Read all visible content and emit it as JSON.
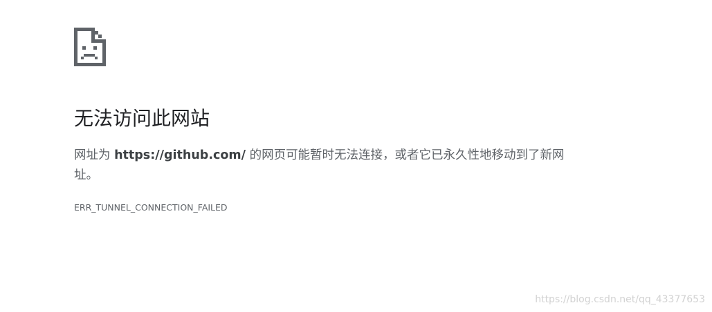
{
  "error_page": {
    "icon": "sad-page-icon",
    "heading": "无法访问此网站",
    "message_prefix": "网址为 ",
    "url": "https://github.com/",
    "message_suffix": " 的网页可能暂时无法连接，或者它已永久性地移动到了新网址。",
    "error_code": "ERR_TUNNEL_CONNECTION_FAILED"
  },
  "watermark": "https://blog.csdn.net/qq_43377653",
  "colors": {
    "icon": "#5f6368",
    "heading": "#202124",
    "text": "#5f6368",
    "background": "#ffffff"
  }
}
